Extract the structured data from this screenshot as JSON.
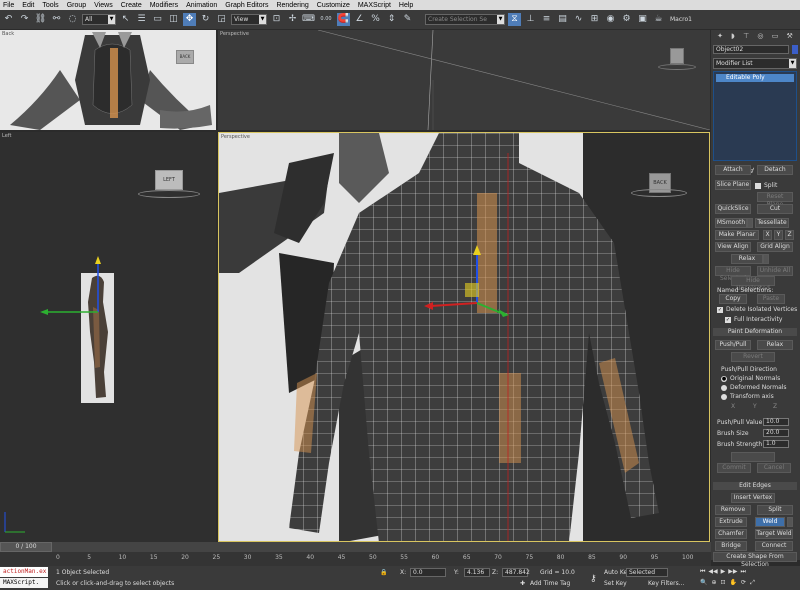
{
  "menu": {
    "items": [
      "File",
      "Edit",
      "Tools",
      "Group",
      "Views",
      "Create",
      "Modifiers",
      "Animation",
      "Graph Editors",
      "Rendering",
      "Customize",
      "MAXScript",
      "Help"
    ]
  },
  "toolbar": {
    "selection_filter": "All",
    "coord_system": "View",
    "numeric_field": "0.00",
    "selection_set_placeholder": "Create Selection Se",
    "macro_label": "Macro1"
  },
  "viewports": {
    "back": {
      "label": "Back",
      "viewcube": "BACK"
    },
    "perspective_top": {
      "label": "Perspective"
    },
    "left": {
      "label": "Left",
      "viewcube": "LEFT"
    },
    "perspective_main": {
      "label": "Perspective",
      "viewcube": "BACK"
    }
  },
  "command_panel": {
    "object_name": "Object02",
    "object_color": "#3b5ec8",
    "modifier_list": "Modifier List",
    "stack_item": "Editable Poly",
    "buttons": {
      "attach": "Attach",
      "detach": "Detach",
      "slice_plane": "Slice Plane",
      "split": "Split",
      "reset_plane": "Reset Plane",
      "quickslice": "QuickSlice",
      "cut": "Cut",
      "msmooth": "MSmooth",
      "tessellate": "Tessellate",
      "make_planar": "Make Planar",
      "x": "X",
      "y": "Y",
      "z": "Z",
      "view_align": "View Align",
      "grid_align": "Grid Align",
      "relax": "Relax",
      "hide_selected": "Hide Selected",
      "unhide_all": "Unhide All",
      "hide_unselected": "Hide Unselected",
      "copy": "Copy",
      "paste": "Paste",
      "push_pull": "Push/Pull",
      "relax2": "Relax",
      "revert": "Revert",
      "commit": "Commit",
      "cancel": "Cancel",
      "insert_vertex": "Insert Vertex",
      "remove": "Remove",
      "split2": "Split",
      "extrude": "Extrude",
      "weld": "Weld",
      "chamfer": "Chamfer",
      "target_weld": "Target Weld",
      "bridge": "Bridge",
      "connect": "Connect",
      "create_shape": "Create Shape From Selection"
    },
    "named_selections": "Named Selections:",
    "delete_isolated": "Delete Isolated Vertices",
    "full_interactivity": "Full Interactivity",
    "paint_deformation": "Paint Deformation",
    "push_pull_direction": "Push/Pull Direction",
    "original_normals": "Original Normals",
    "deformed_normals": "Deformed Normals",
    "transform_axis": "Transform axis",
    "axis_x": "X",
    "axis_y": "Y",
    "axis_z": "Z",
    "push_pull_value_label": "Push/Pull Value",
    "push_pull_value": "10.0",
    "brush_size_label": "Brush Size",
    "brush_size": "20.0",
    "brush_strength_label": "Brush Strength",
    "brush_strength": "1.0",
    "brush_options": "Brush Options",
    "edit_edges": "Edit Edges"
  },
  "timeline": {
    "frame_display": "0 / 100",
    "ticks": [
      "0",
      "5",
      "10",
      "15",
      "20",
      "25",
      "30",
      "35",
      "40",
      "45",
      "50",
      "55",
      "60",
      "65",
      "70",
      "75",
      "80",
      "85",
      "90",
      "95",
      "100"
    ]
  },
  "status": {
    "maxscript_input": "actionMan.ex",
    "maxscript_label": "MAXScript.",
    "selected_count": "1 Object Selected",
    "prompt": "Click or click-and-drag to select objects",
    "x_label": "X:",
    "x_value": "0.0",
    "y_label": "Y:",
    "y_value": "4.136",
    "z_label": "Z:",
    "z_value": "487.842",
    "grid": "Grid = 10.0",
    "add_time_tag": "Add Time Tag",
    "auto_key": "Auto Key",
    "set_key": "Set Key",
    "key_mode": "Selected",
    "key_filters": "Key Filters..."
  }
}
